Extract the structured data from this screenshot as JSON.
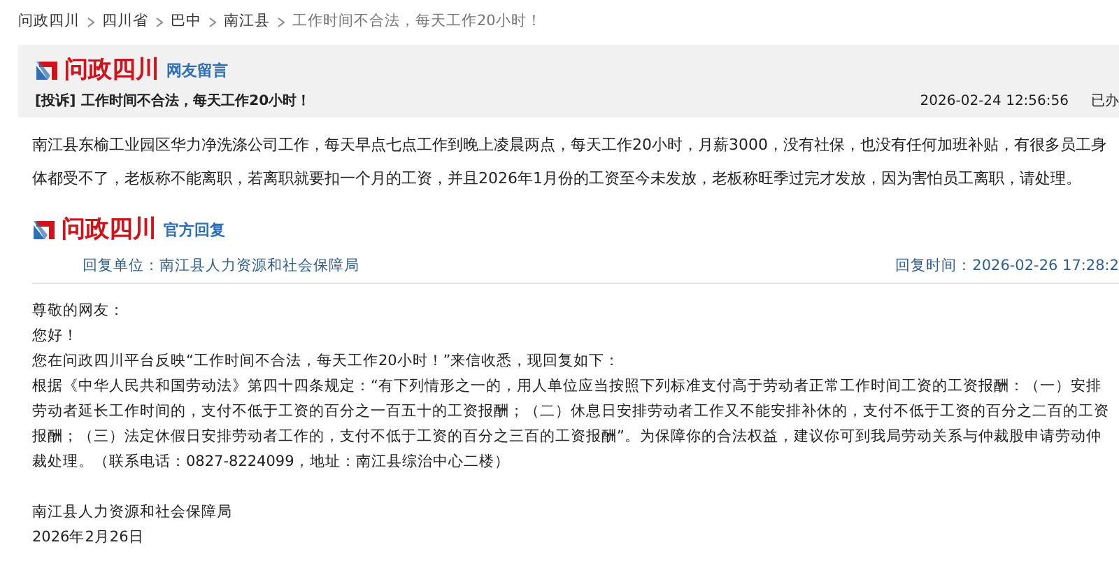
{
  "breadcrumb": [
    "问政四川",
    "四川省",
    "巴中",
    "南江县",
    "工作时间不合法，每天工作20小时！"
  ],
  "question": {
    "brand": "问政四川",
    "section": "网友留言",
    "tag": "[投诉]",
    "title": "工作时间不合法，每天工作20小时！",
    "time": "2026-02-24 12:56:56",
    "status": "已办",
    "body": "南江县东榆工业园区华力净洗涤公司工作，每天早点七点工作到晚上凌晨两点，每天工作20小时，月薪3000，没有社保，也没有任何加班补贴，有很多员工身体都受不了，老板称不能离职，若离职就要扣一个月的工资，并且2026年1月份的工资至今未发放，老板称旺季过完才发放，因为害怕员工离职，请处理。"
  },
  "reply": {
    "brand": "问政四川",
    "section": "官方回复",
    "unit_label": "回复单位：",
    "unit": "南江县人力资源和社会保障局",
    "time_label": "回复时间：",
    "time": "2026-02-26 17:28:2",
    "paragraphs": [
      "尊敬的网友：",
      "您好！",
      "您在问政四川平台反映“工作时间不合法，每天工作20小时！”来信收悉，现回复如下：",
      "根据《中华人民共和国劳动法》第四十四条规定：“有下列情形之一的，用人单位应当按照下列标准支付高于劳动者正常工作时间工资的工资报酬：（一）安排劳动者延长工作时间的，支付不低于工资的百分之一百五十的工资报酬；（二）休息日安排劳动者工作又不能安排补休的，支付不低于工资的百分之二百的工资报酬；（三）法定休假日安排劳动者工作的，支付不低于工资的百分之三百的工资报酬”。为保障你的合法权益，建议你可到我局劳动关系与仲裁股申请劳动仲裁处理。（联系电话：0827-8224099，地址：南江县综治中心二楼）"
    ],
    "signature": "南江县人力资源和社会保障局",
    "date": "2026年2月26日"
  }
}
